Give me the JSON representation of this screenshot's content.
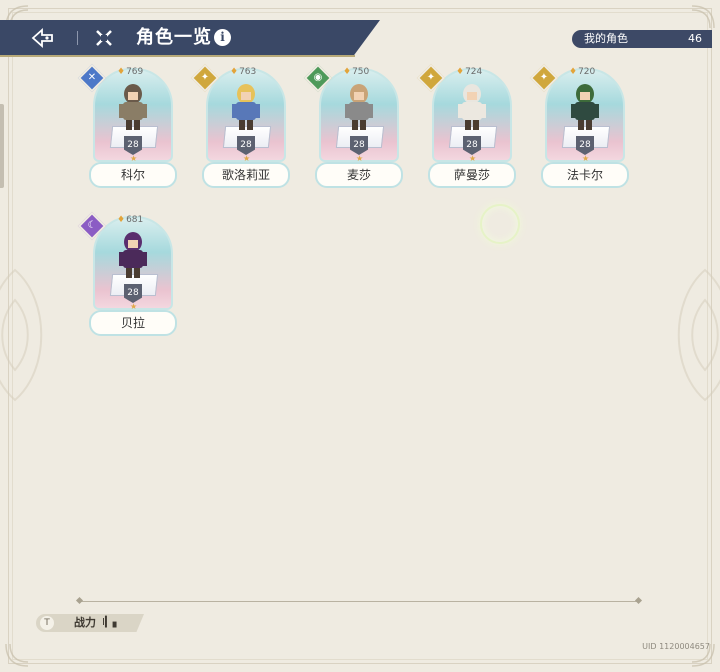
{
  "header": {
    "title": "角色一览",
    "info_glyph": "i",
    "back_icon": "back-arrow-icon",
    "menu_icon": "grid-menu-icon"
  },
  "owned": {
    "label": "我的角色",
    "count": "46"
  },
  "characters": [
    {
      "name": "科尔",
      "power": "769",
      "level": "28",
      "element": "wind",
      "element_color": "#4d78c8",
      "element_glyph": "✕"
    },
    {
      "name": "歌洛莉亚",
      "power": "763",
      "level": "28",
      "element": "light",
      "element_color": "#d0a73c",
      "element_glyph": "✦"
    },
    {
      "name": "麦莎",
      "power": "750",
      "level": "28",
      "element": "earth",
      "element_color": "#4e9a5a",
      "element_glyph": "◉"
    },
    {
      "name": "萨曼莎",
      "power": "724",
      "level": "28",
      "element": "light",
      "element_color": "#d0a73c",
      "element_glyph": "✦"
    },
    {
      "name": "法卡尔",
      "power": "720",
      "level": "28",
      "element": "light",
      "element_color": "#d0a73c",
      "element_glyph": "✦"
    },
    {
      "name": "贝拉",
      "power": "681",
      "level": "28",
      "element": "dark",
      "element_color": "#8b5cc4",
      "element_glyph": "☾"
    }
  ],
  "sort": {
    "label": "战力",
    "bars_glyph": "Ⅰ▎▖",
    "icon_glyph": "T"
  },
  "uid": "UID 1120004657",
  "colors": {
    "header_bg": "#3a4866",
    "page_bg": "#efebe1",
    "card_top": "#a6d9dd",
    "card_bottom": "#f3d7df"
  }
}
